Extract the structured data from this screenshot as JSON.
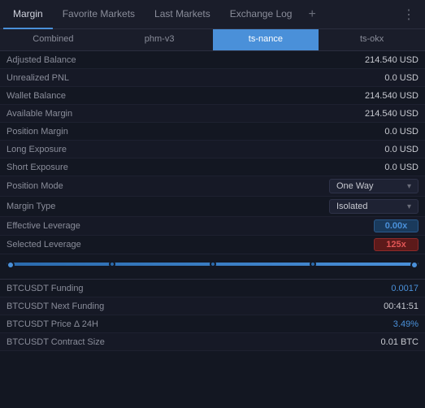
{
  "topNav": {
    "tabs": [
      {
        "label": "Margin",
        "active": true
      },
      {
        "label": "Favorite Markets",
        "active": false
      },
      {
        "label": "Last Markets",
        "active": false
      },
      {
        "label": "Exchange Log",
        "active": false
      }
    ],
    "plus": "+",
    "more": "⋮"
  },
  "subTabs": [
    {
      "label": "Combined",
      "active": false
    },
    {
      "label": "phm-v3",
      "active": false
    },
    {
      "label": "ts-nance",
      "active": true
    },
    {
      "label": "ts-okx",
      "active": false
    }
  ],
  "rows": [
    {
      "label": "Adjusted Balance",
      "value": "214.540 USD",
      "highlight": false
    },
    {
      "label": "Unrealized PNL",
      "value": "0.0 USD",
      "highlight": false
    },
    {
      "label": "Wallet Balance",
      "value": "214.540 USD",
      "highlight": false
    },
    {
      "label": "Available Margin",
      "value": "214.540 USD",
      "highlight": false
    },
    {
      "label": "Position Margin",
      "value": "0.0 USD",
      "highlight": false
    },
    {
      "label": "Long Exposure",
      "value": "0.0 USD",
      "highlight": false
    },
    {
      "label": "Short Exposure",
      "value": "0.0 USD",
      "highlight": false
    }
  ],
  "positionMode": {
    "label": "Position Mode",
    "value": "One Way"
  },
  "marginType": {
    "label": "Margin Type",
    "value": "Isolated"
  },
  "effectiveLeverage": {
    "label": "Effective Leverage",
    "value": "0.00x"
  },
  "selectedLeverage": {
    "label": "Selected Leverage",
    "value": "125x"
  },
  "fundingRows": [
    {
      "label": "BTCUSDT Funding",
      "value": "0.0017",
      "highlight": true
    },
    {
      "label": "BTCUSDT Next Funding",
      "value": "00:41:51",
      "highlight": false
    },
    {
      "label": "BTCUSDT Price Δ 24H",
      "value": "3.49%",
      "highlight": true
    },
    {
      "label": "BTCUSDT Contract Size",
      "value": "0.01 BTC",
      "highlight": false
    }
  ]
}
